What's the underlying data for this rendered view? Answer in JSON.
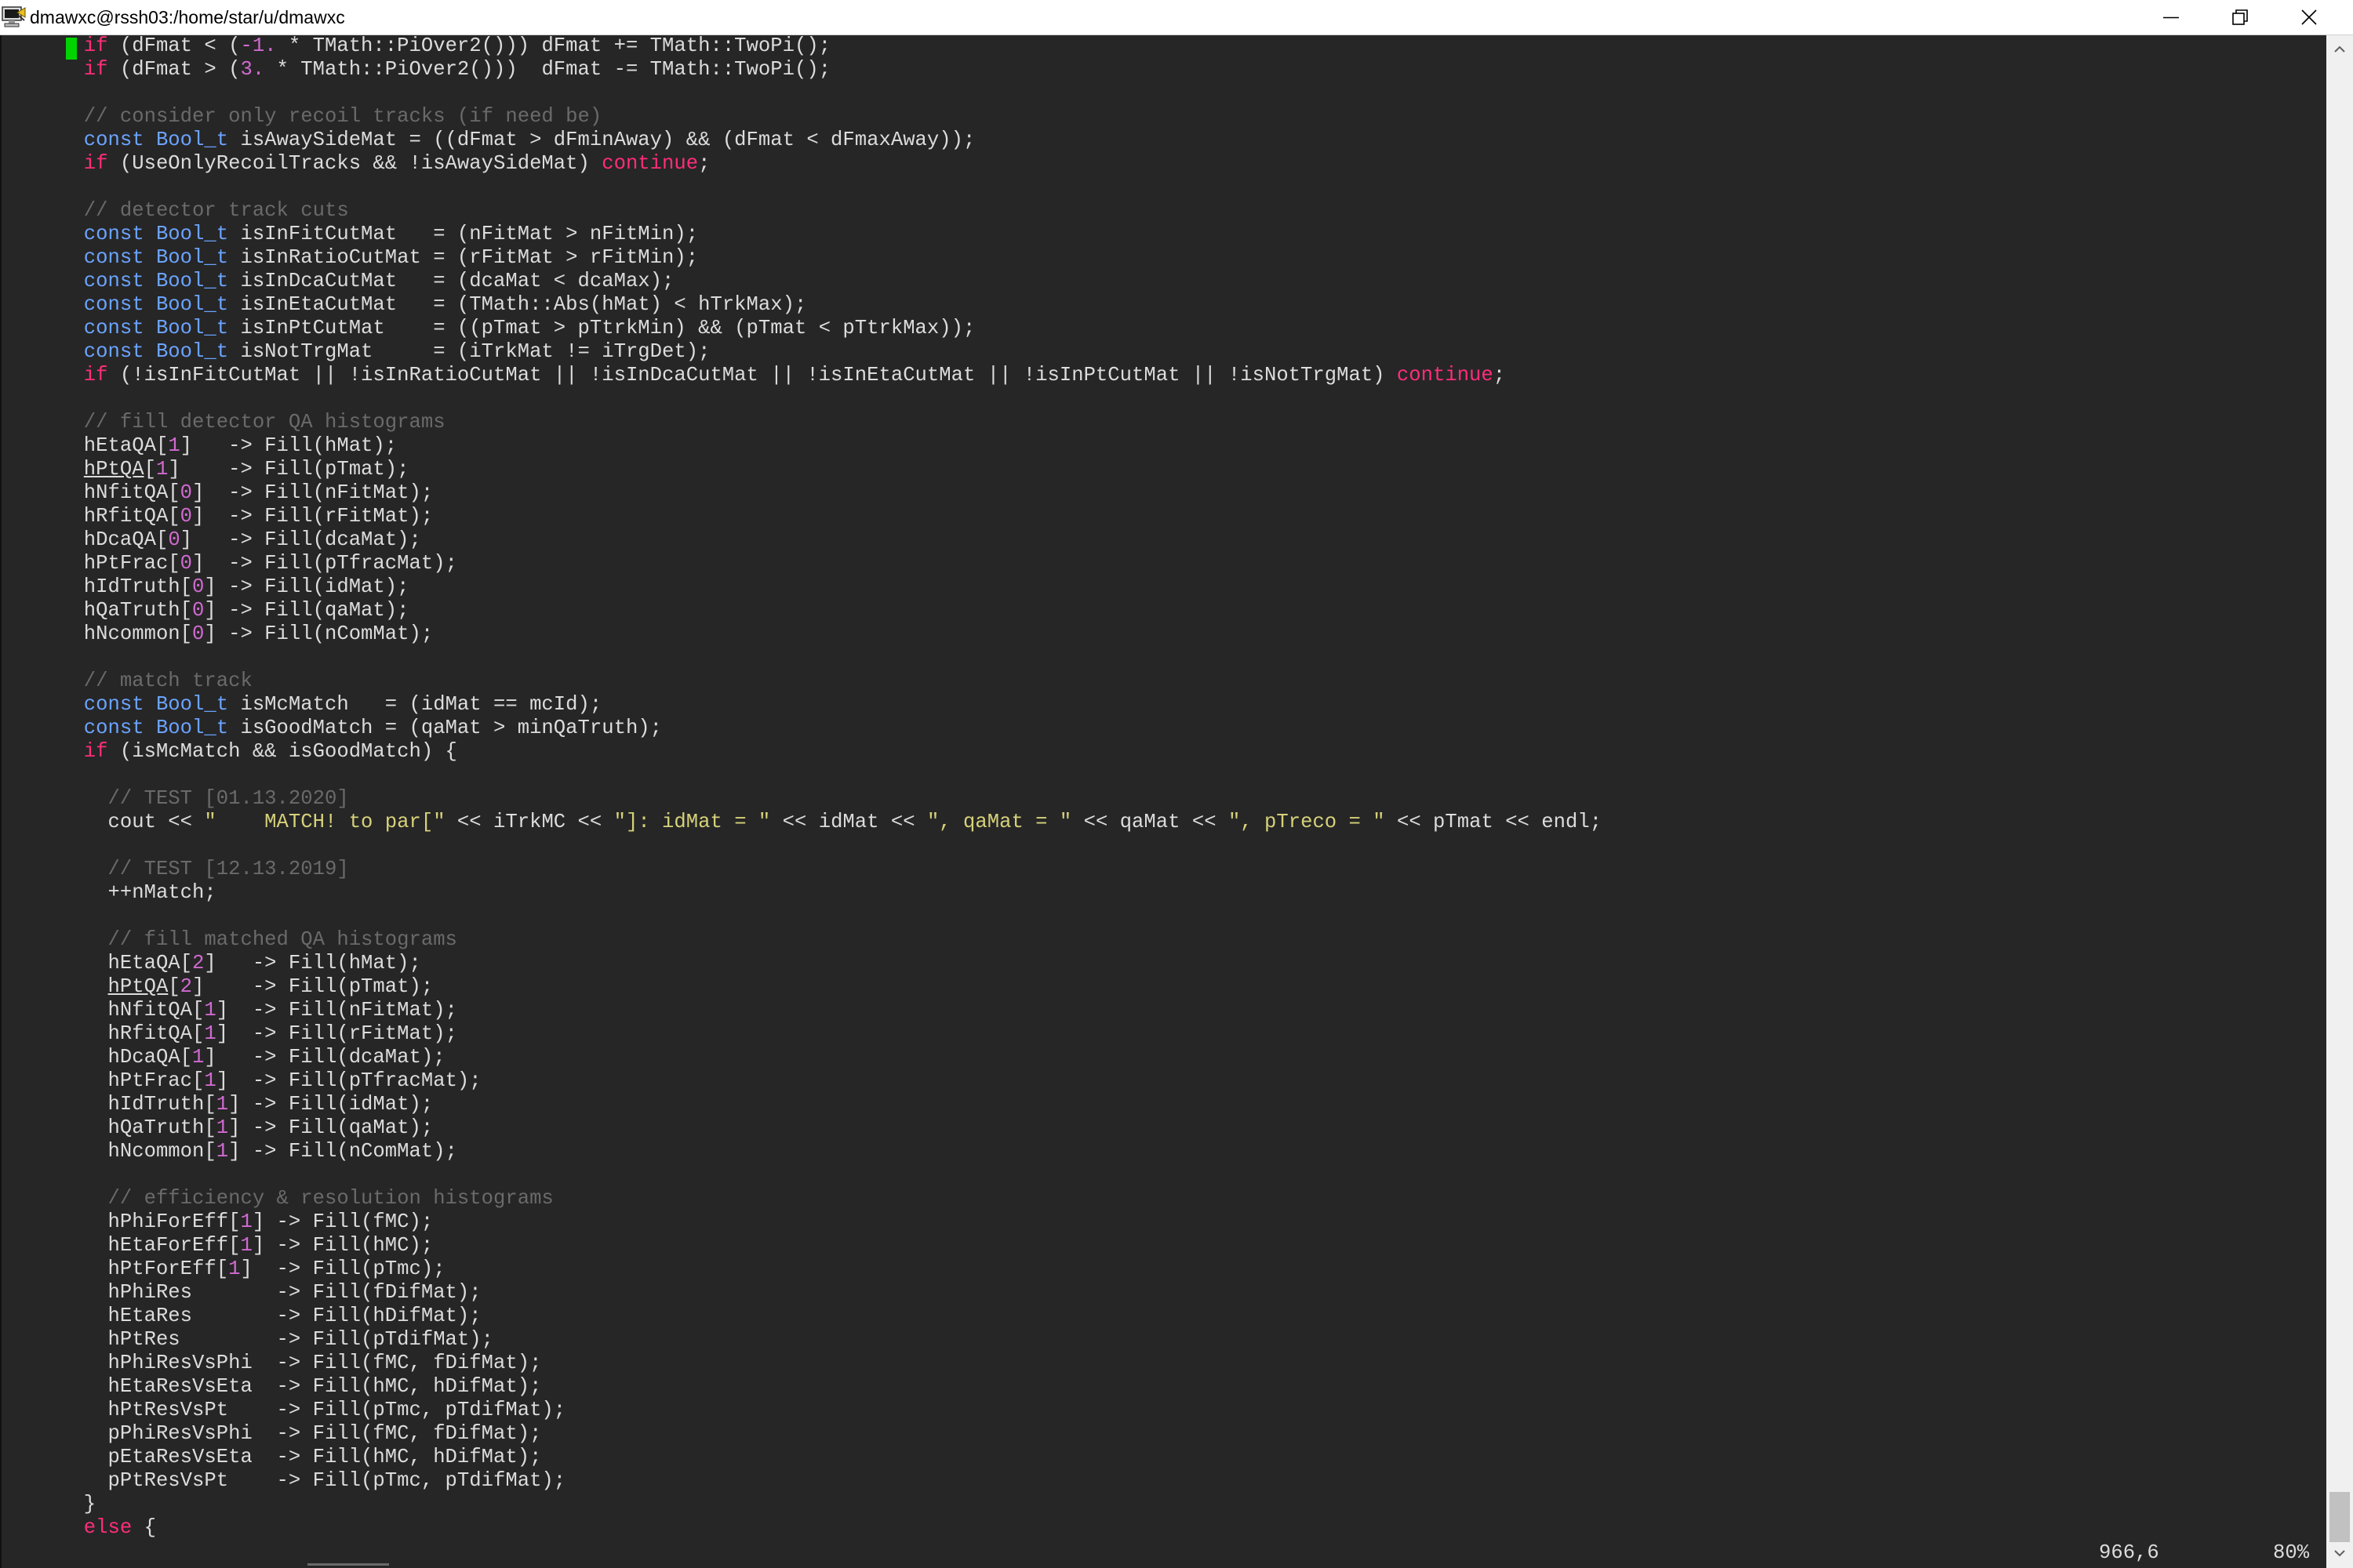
{
  "window": {
    "title": "dmawxc@rssh03:/home/star/u/dmawxc",
    "icons": {
      "app": "putty-terminal-icon",
      "minimize": "minimize-icon",
      "maximize": "restore-icon",
      "close": "close-icon"
    }
  },
  "editor": {
    "lines": [
      "     if (dFmat < (-1. * TMath::PiOver2())) dFmat += TMath::TwoPi();",
      "     if (dFmat > (3. * TMath::PiOver2()))  dFmat -= TMath::TwoPi();",
      "",
      "     // consider only recoil tracks (if need be)",
      "     const Bool_t isAwaySideMat = ((dFmat > dFminAway) && (dFmat < dFmaxAway));",
      "     if (UseOnlyRecoilTracks && !isAwaySideMat) continue;",
      "",
      "     // detector track cuts",
      "     const Bool_t isInFitCutMat   = (nFitMat > nFitMin);",
      "     const Bool_t isInRatioCutMat = (rFitMat > rFitMin);",
      "     const Bool_t isInDcaCutMat   = (dcaMat < dcaMax);",
      "     const Bool_t isInEtaCutMat   = (TMath::Abs(hMat) < hTrkMax);",
      "     const Bool_t isInPtCutMat    = ((pTmat > pTtrkMin) && (pTmat < pTtrkMax));",
      "     const Bool_t isNotTrgMat     = (iTrkMat != iTrgDet);",
      "     if (!isInFitCutMat || !isInRatioCutMat || !isInDcaCutMat || !isInEtaCutMat || !isInPtCutMat || !isNotTrgMat) continue;",
      "",
      "     // fill detector QA histograms",
      "     hEtaQA[1]   -> Fill(hMat);",
      "     hPtQA[1]    -> Fill(pTmat);",
      "     hNfitQA[0]  -> Fill(nFitMat);",
      "     hRfitQA[0]  -> Fill(rFitMat);",
      "     hDcaQA[0]   -> Fill(dcaMat);",
      "     hPtFrac[0]  -> Fill(pTfracMat);",
      "     hIdTruth[0] -> Fill(idMat);",
      "     hQaTruth[0] -> Fill(qaMat);",
      "     hNcommon[0] -> Fill(nComMat);",
      "",
      "     // match track",
      "     const Bool_t isMcMatch   = (idMat == mcId);",
      "     const Bool_t isGoodMatch = (qaMat > minQaTruth);",
      "     if (isMcMatch && isGoodMatch) {",
      "",
      "       // TEST [01.13.2020]",
      "       cout << \"    MATCH! to par[\" << iTrkMC << \"]: idMat = \" << idMat << \", qaMat = \" << qaMat << \", pTreco = \" << pTmat << endl;",
      "",
      "       // TEST [12.13.2019]",
      "       ++nMatch;",
      "",
      "       // fill matched QA histograms",
      "       hEtaQA[2]   -> Fill(hMat);",
      "       hPtQA[2]    -> Fill(pTmat);",
      "       hNfitQA[1]  -> Fill(nFitMat);",
      "       hRfitQA[1]  -> Fill(rFitMat);",
      "       hDcaQA[1]   -> Fill(dcaMat);",
      "       hPtFrac[1]  -> Fill(pTfracMat);",
      "       hIdTruth[1] -> Fill(idMat);",
      "       hQaTruth[1] -> Fill(qaMat);",
      "       hNcommon[1] -> Fill(nComMat);",
      "",
      "       // efficiency & resolution histograms",
      "       hPhiForEff[1] -> Fill(fMC);",
      "       hEtaForEff[1] -> Fill(hMC);",
      "       hPtForEff[1]  -> Fill(pTmc);",
      "       hPhiRes       -> Fill(fDifMat);",
      "       hEtaRes       -> Fill(hDifMat);",
      "       hPtRes        -> Fill(pTdifMat);",
      "       hPhiResVsPhi  -> Fill(fMC, fDifMat);",
      "       hEtaResVsEta  -> Fill(hMC, hDifMat);",
      "       hPtResVsPt    -> Fill(pTmc, pTdifMat);",
      "       pPhiResVsPhi  -> Fill(fMC, fDifMat);",
      "       pEtaResVsEta  -> Fill(hMC, hDifMat);",
      "       pPtResVsPt    -> Fill(pTmc, pTdifMat);",
      "     }",
      "     else {"
    ],
    "colors": {
      "background": "#262626",
      "text": "#dcdcdc",
      "keyword": "#ff2d7a",
      "type": "#6ba3ff",
      "comment": "#6a6a6a",
      "string": "#d6d17a",
      "number": "#d06ad0",
      "cursor": "#00d400"
    }
  },
  "status": {
    "position": "966,6",
    "percent": "80%"
  }
}
